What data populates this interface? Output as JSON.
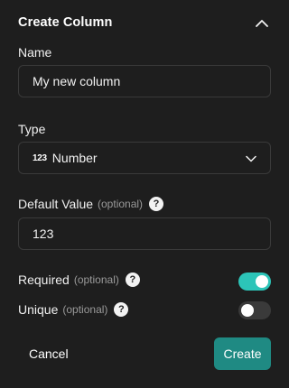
{
  "header": {
    "title": "Create Column",
    "collapse_icon": "chevron-up-icon"
  },
  "name_field": {
    "label": "Name",
    "value": "My new column"
  },
  "type_field": {
    "label": "Type",
    "icon_text": "123",
    "value": "Number",
    "dropdown_icon": "chevron-down-icon"
  },
  "default_value_field": {
    "label": "Default Value",
    "optional": "(optional)",
    "help": "?",
    "value": "123"
  },
  "required_toggle": {
    "label": "Required",
    "optional": "(optional)",
    "help": "?",
    "checked": true
  },
  "unique_toggle": {
    "label": "Unique",
    "optional": "(optional)",
    "help": "?",
    "checked": false
  },
  "actions": {
    "cancel_label": "Cancel",
    "create_label": "Create"
  },
  "colors": {
    "background": "#1e1e1e",
    "border": "#3a3a3a",
    "accent_toggle": "#2cc4b8",
    "accent_button": "#1f8a83",
    "muted_text": "#9a9a9a"
  }
}
